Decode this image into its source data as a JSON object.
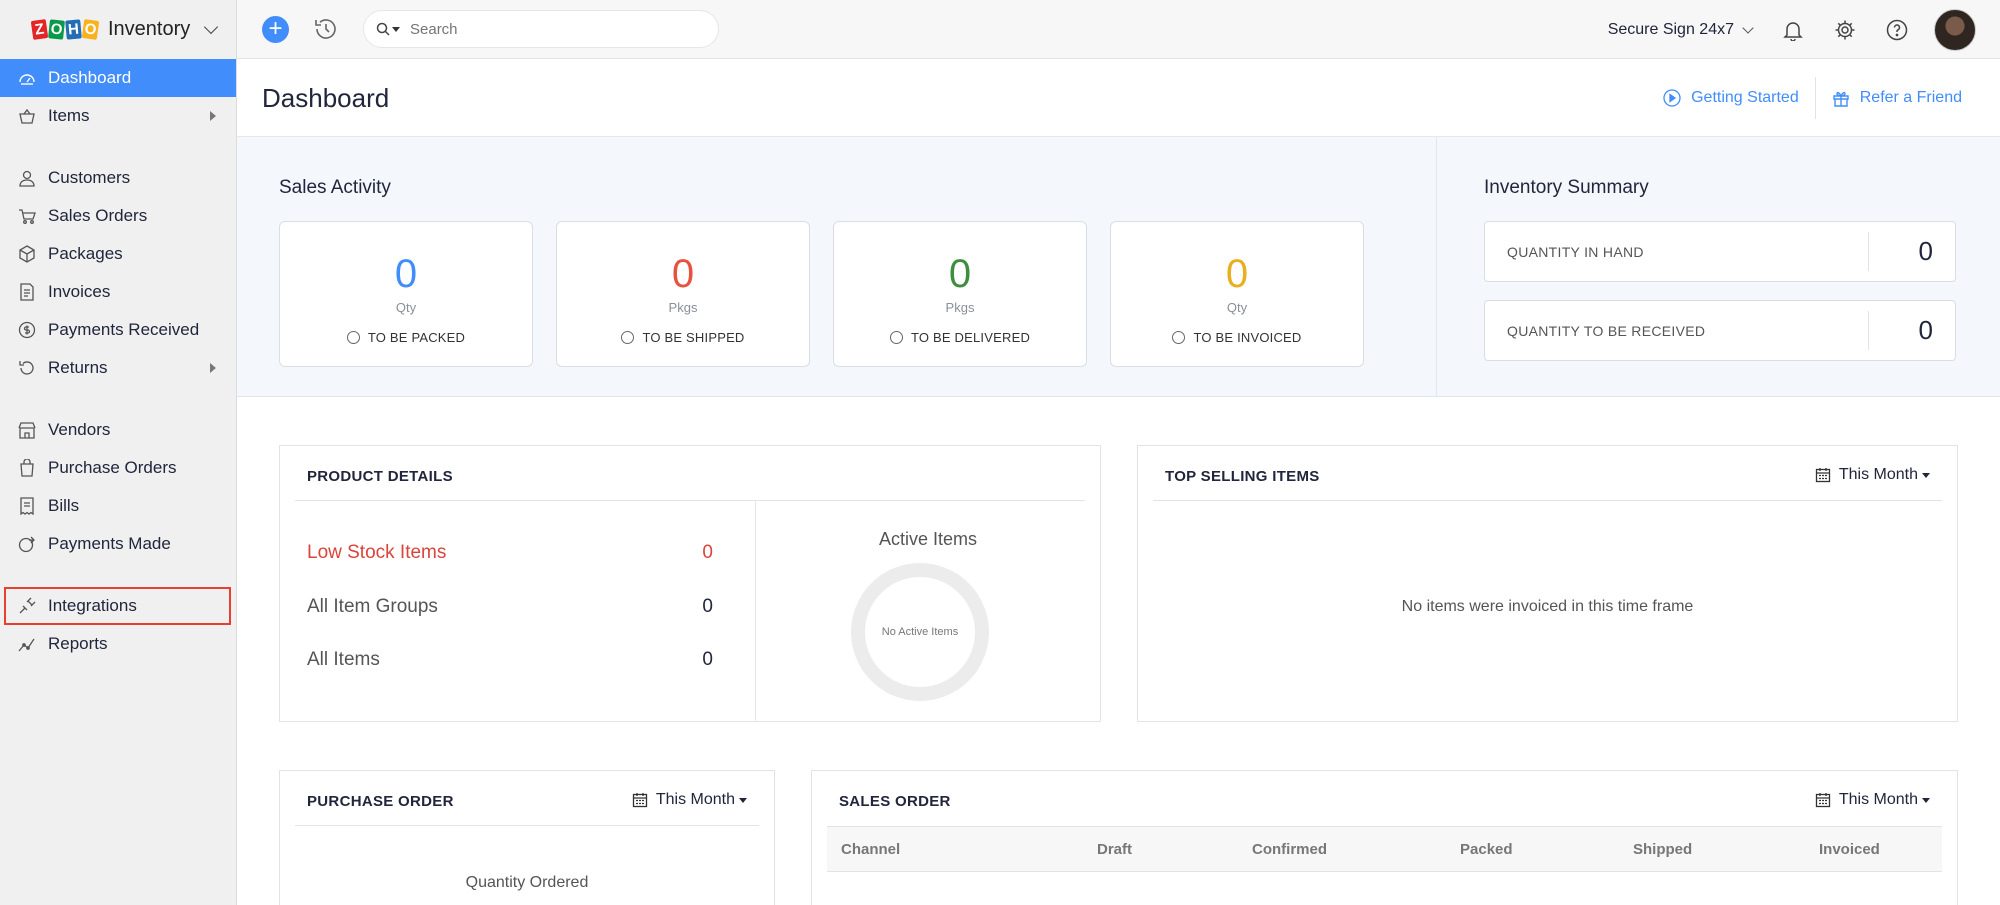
{
  "app": {
    "logo_text": "ZOHO",
    "name": "Inventory"
  },
  "sidebar": {
    "items": [
      {
        "label": "Dashboard",
        "icon": "dashboard-icon",
        "active": true
      },
      {
        "label": "Items",
        "icon": "basket-icon",
        "has_submenu": true
      },
      {
        "label": "Customers",
        "icon": "user-icon"
      },
      {
        "label": "Sales Orders",
        "icon": "cart-icon"
      },
      {
        "label": "Packages",
        "icon": "package-icon"
      },
      {
        "label": "Invoices",
        "icon": "invoice-icon"
      },
      {
        "label": "Payments Received",
        "icon": "payment-icon"
      },
      {
        "label": "Returns",
        "icon": "return-icon",
        "has_submenu": true
      },
      {
        "label": "Vendors",
        "icon": "store-icon"
      },
      {
        "label": "Purchase Orders",
        "icon": "bag-icon"
      },
      {
        "label": "Bills",
        "icon": "bill-icon"
      },
      {
        "label": "Payments Made",
        "icon": "payment-made-icon"
      },
      {
        "label": "Integrations",
        "icon": "integration-icon",
        "highlighted": true
      },
      {
        "label": "Reports",
        "icon": "chart-line-icon"
      }
    ]
  },
  "topbar": {
    "search_placeholder": "Search",
    "organization": "Secure Sign 24x7"
  },
  "page": {
    "title": "Dashboard",
    "getting_started": "Getting Started",
    "refer_friend": "Refer a Friend"
  },
  "sales_activity": {
    "title": "Sales Activity",
    "cards": [
      {
        "value": "0",
        "unit": "Qty",
        "label": "TO BE PACKED",
        "color": "#408dfb"
      },
      {
        "value": "0",
        "unit": "Pkgs",
        "label": "TO BE SHIPPED",
        "color": "#e5533f"
      },
      {
        "value": "0",
        "unit": "Pkgs",
        "label": "TO BE DELIVERED",
        "color": "#3e8e41"
      },
      {
        "value": "0",
        "unit": "Qty",
        "label": "TO BE INVOICED",
        "color": "#e8b020"
      }
    ]
  },
  "inventory_summary": {
    "title": "Inventory Summary",
    "rows": [
      {
        "label": "QUANTITY IN HAND",
        "value": "0"
      },
      {
        "label": "QUANTITY TO BE RECEIVED",
        "value": "0"
      }
    ]
  },
  "product_details": {
    "title": "PRODUCT DETAILS",
    "rows": [
      {
        "label": "Low Stock Items",
        "value": "0"
      },
      {
        "label": "All Item Groups",
        "value": "0"
      },
      {
        "label": "All Items",
        "value": "0"
      }
    ],
    "active_items_title": "Active Items",
    "donut_text": "No Active Items"
  },
  "top_selling": {
    "title": "TOP SELLING ITEMS",
    "period": "This Month",
    "empty": "No items were invoiced in this time frame"
  },
  "purchase_order": {
    "title": "PURCHASE ORDER",
    "period": "This Month",
    "subtitle": "Quantity Ordered"
  },
  "sales_order": {
    "title": "SALES ORDER",
    "period": "This Month",
    "columns": [
      "Channel",
      "Draft",
      "Confirmed",
      "Packed",
      "Shipped",
      "Invoiced"
    ]
  }
}
